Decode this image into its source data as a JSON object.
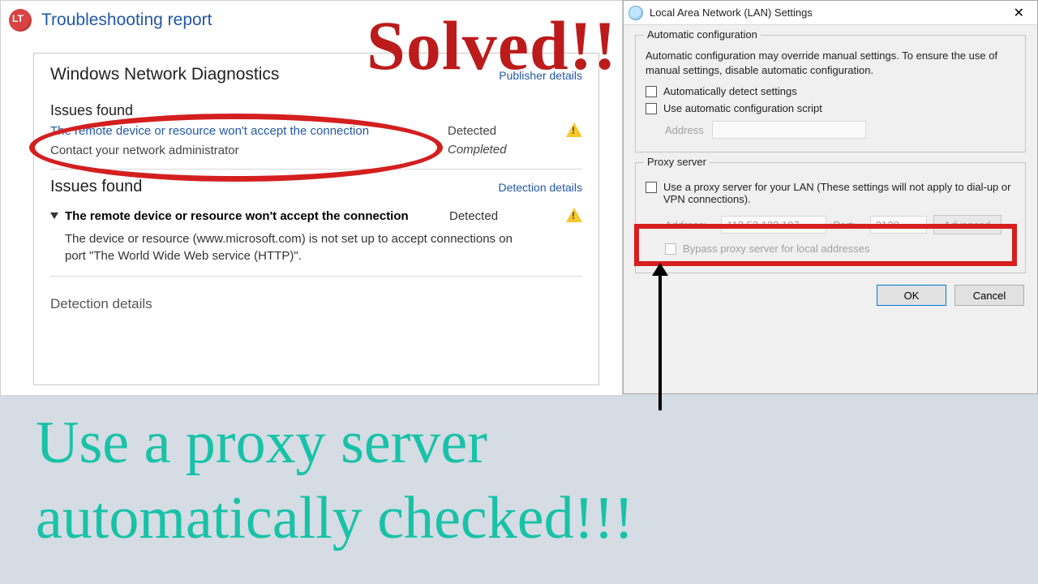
{
  "overlay": {
    "solved": "Solved!!",
    "big_caption_line1": "Use a proxy server",
    "big_caption_line2": "automatically checked!!!"
  },
  "troubleshoot": {
    "title": "Troubleshooting report",
    "diag_title": "Windows Network Diagnostics",
    "publisher_link": "Publisher details",
    "issues_found_label": "Issues found",
    "issue1_text": "The remote device or resource won't accept the connection",
    "issue1_status": "Detected",
    "issue1_sub": "Contact your network administrator",
    "issue1_sub_status": "Completed",
    "issues_found_label2": "Issues found",
    "detection_link": "Detection details",
    "issue2_text": "The remote device or resource won't accept the connection",
    "issue2_status": "Detected",
    "issue2_desc": "The device or resource (www.microsoft.com) is not set up to accept connections on port \"The World Wide Web service (HTTP)\".",
    "cutoff": "Detection details"
  },
  "lan": {
    "title": "Local Area Network (LAN) Settings",
    "auto": {
      "group": "Automatic configuration",
      "desc": "Automatic configuration may override manual settings.  To ensure the use of manual settings, disable automatic configuration.",
      "chk_detect": "Automatically detect settings",
      "chk_script": "Use automatic configuration script",
      "addr_label": "Address"
    },
    "proxy": {
      "group": "Proxy server",
      "chk_use": "Use a proxy server for your LAN (These settings will not apply to dial-up or VPN connections).",
      "addr_label": "Address:",
      "addr_value": "113.53.122.197",
      "port_label": "Port:",
      "port_value": "3128",
      "advanced": "Advanced",
      "chk_bypass": "Bypass proxy server for local addresses"
    },
    "ok": "OK",
    "cancel": "Cancel"
  }
}
